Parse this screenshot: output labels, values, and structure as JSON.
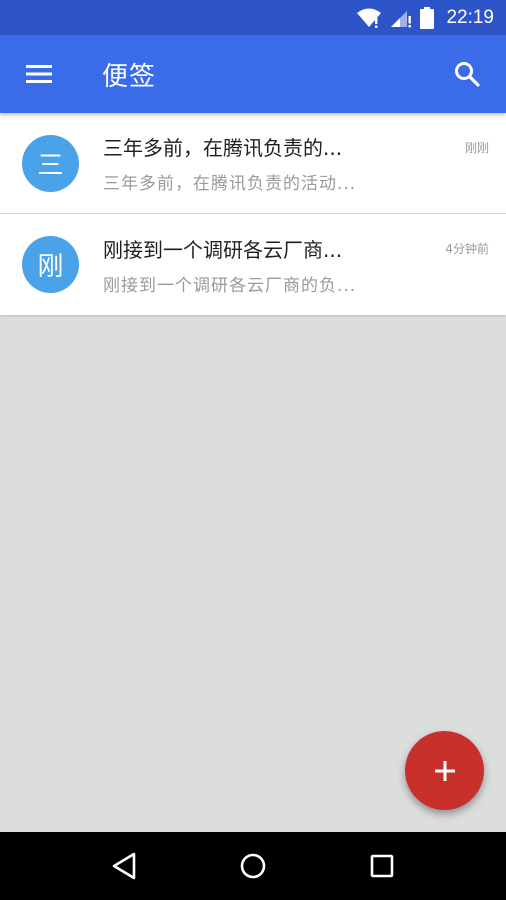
{
  "status_bar": {
    "time": "22:19",
    "icons": [
      "wifi-icon",
      "signal-icon",
      "battery-icon"
    ]
  },
  "app_bar": {
    "title": "便签",
    "menu_icon": "menu-icon",
    "search_icon": "search-icon",
    "color": "#3a6be8"
  },
  "notes": [
    {
      "avatar": "三",
      "title": "三年多前，在腾讯负责的...",
      "preview": "三年多前，在腾讯负责的活动...",
      "time": "刚刚"
    },
    {
      "avatar": "刚",
      "title": "刚接到一个调研各云厂商...",
      "preview": "刚接到一个调研各云厂商的负...",
      "time": "4分钟前"
    }
  ],
  "fab": {
    "icon": "plus-icon",
    "color": "#c9302c"
  },
  "nav_bar": {
    "icons": [
      "back-icon",
      "home-icon",
      "recents-icon"
    ]
  }
}
